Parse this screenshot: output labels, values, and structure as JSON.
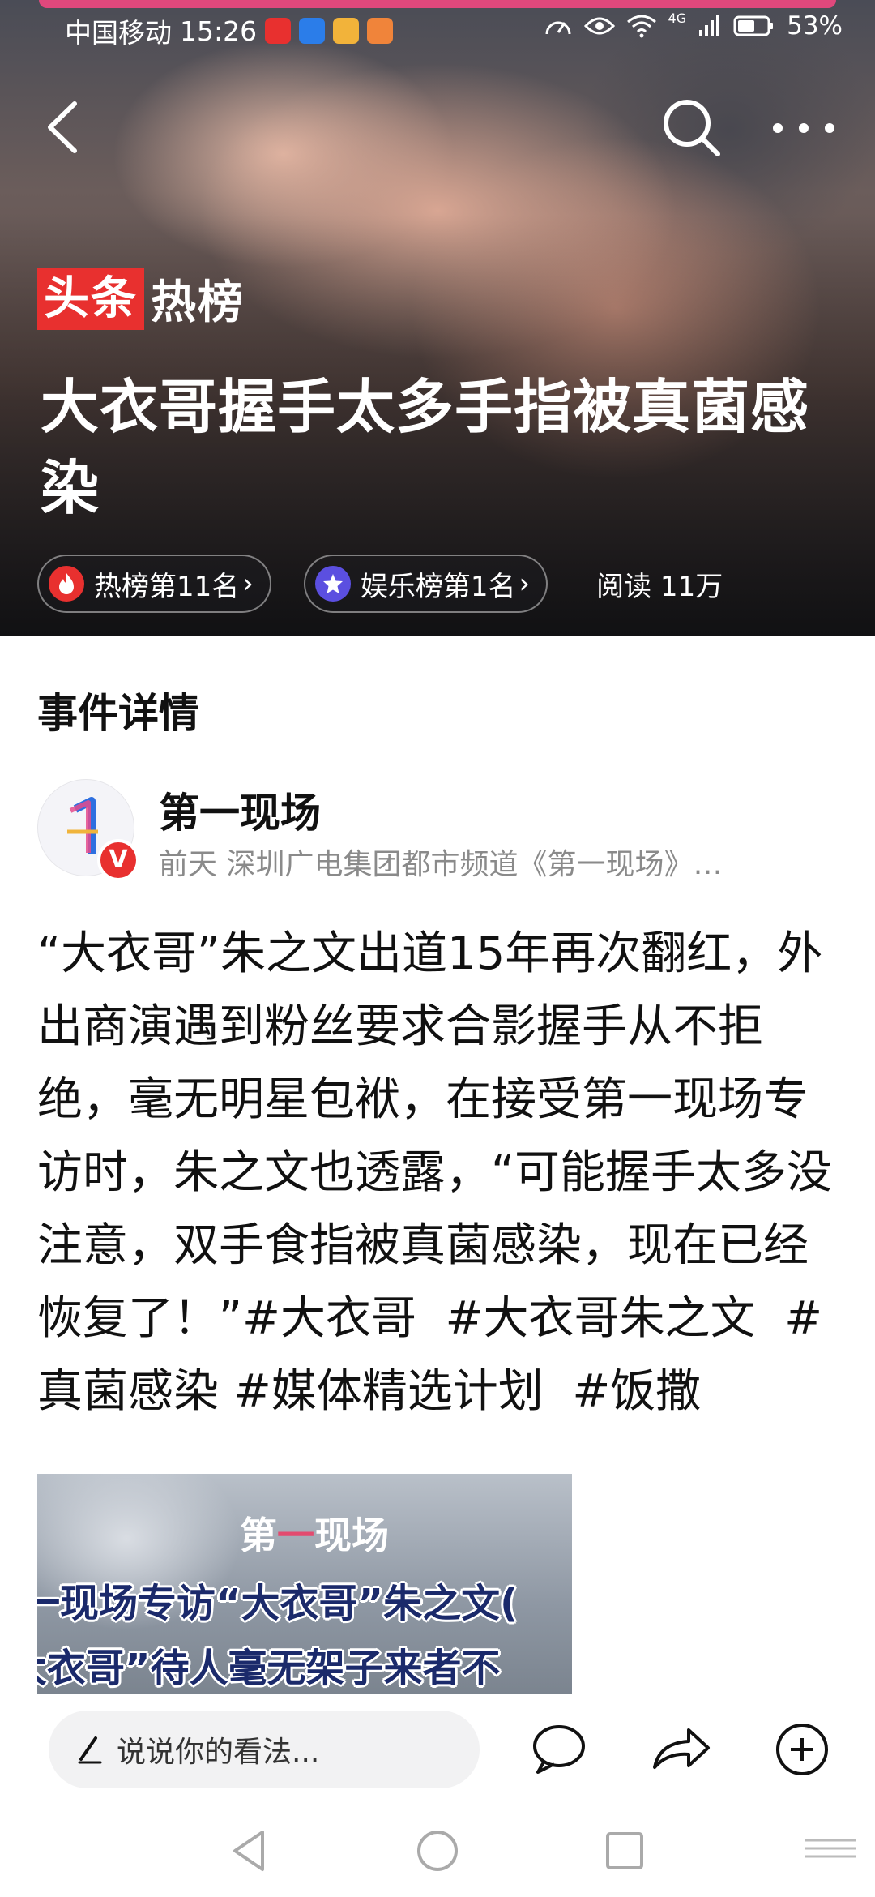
{
  "status_bar": {
    "carrier": "中国移动",
    "time": "15:26",
    "network": "4G",
    "battery": "53%"
  },
  "nav": {
    "back_icon": "chevron-left-icon",
    "search_icon": "search-icon",
    "more_icon": "more-dots-icon"
  },
  "hero": {
    "brand_red": "头条",
    "brand_white": "热榜",
    "title": "大衣哥握手太多手指被真菌感染",
    "chips": [
      {
        "label": "热榜第11名",
        "icon": "fire-icon",
        "color": "#e8302f"
      },
      {
        "label": "娱乐榜第1名",
        "icon": "star-icon",
        "color": "#5b4fe0"
      }
    ],
    "read_label": "阅读 11万"
  },
  "section": {
    "title": "事件详情"
  },
  "author": {
    "name": "第一现场",
    "verified_badge": "V",
    "meta": "前天  深圳广电集团都市频道《第一现场》…"
  },
  "article": {
    "text": "“大衣哥”朱之文出道15年再次翻红，外出商演遇到粉丝要求合影握手从不拒绝，毫无明星包袱，在接受第一现场专访时，朱之文也透露，“可能握手太多没注意，双手食指被真菌感染，现在已经恢复了！”",
    "hashtags": [
      "#大衣哥",
      "#大衣哥朱之文",
      "#真菌感染",
      "#媒体精选计划",
      "#饭撒"
    ]
  },
  "video": {
    "logo_a": "第",
    "logo_one": "一",
    "logo_b": "现场",
    "caption_1": "一现场专访“大衣哥”朱之文(",
    "caption_2": "大衣哥”待人毫无架子来者不"
  },
  "action_bar": {
    "comment_placeholder": "说说你的看法...",
    "comment_icon": "comment-bubble-icon",
    "share_icon": "share-arrow-icon",
    "add_icon": "add-circle-icon"
  },
  "colors": {
    "brand_red": "#e8302f",
    "accent_purple": "#5b4fe0",
    "muted_text": "#8a8a8a"
  }
}
